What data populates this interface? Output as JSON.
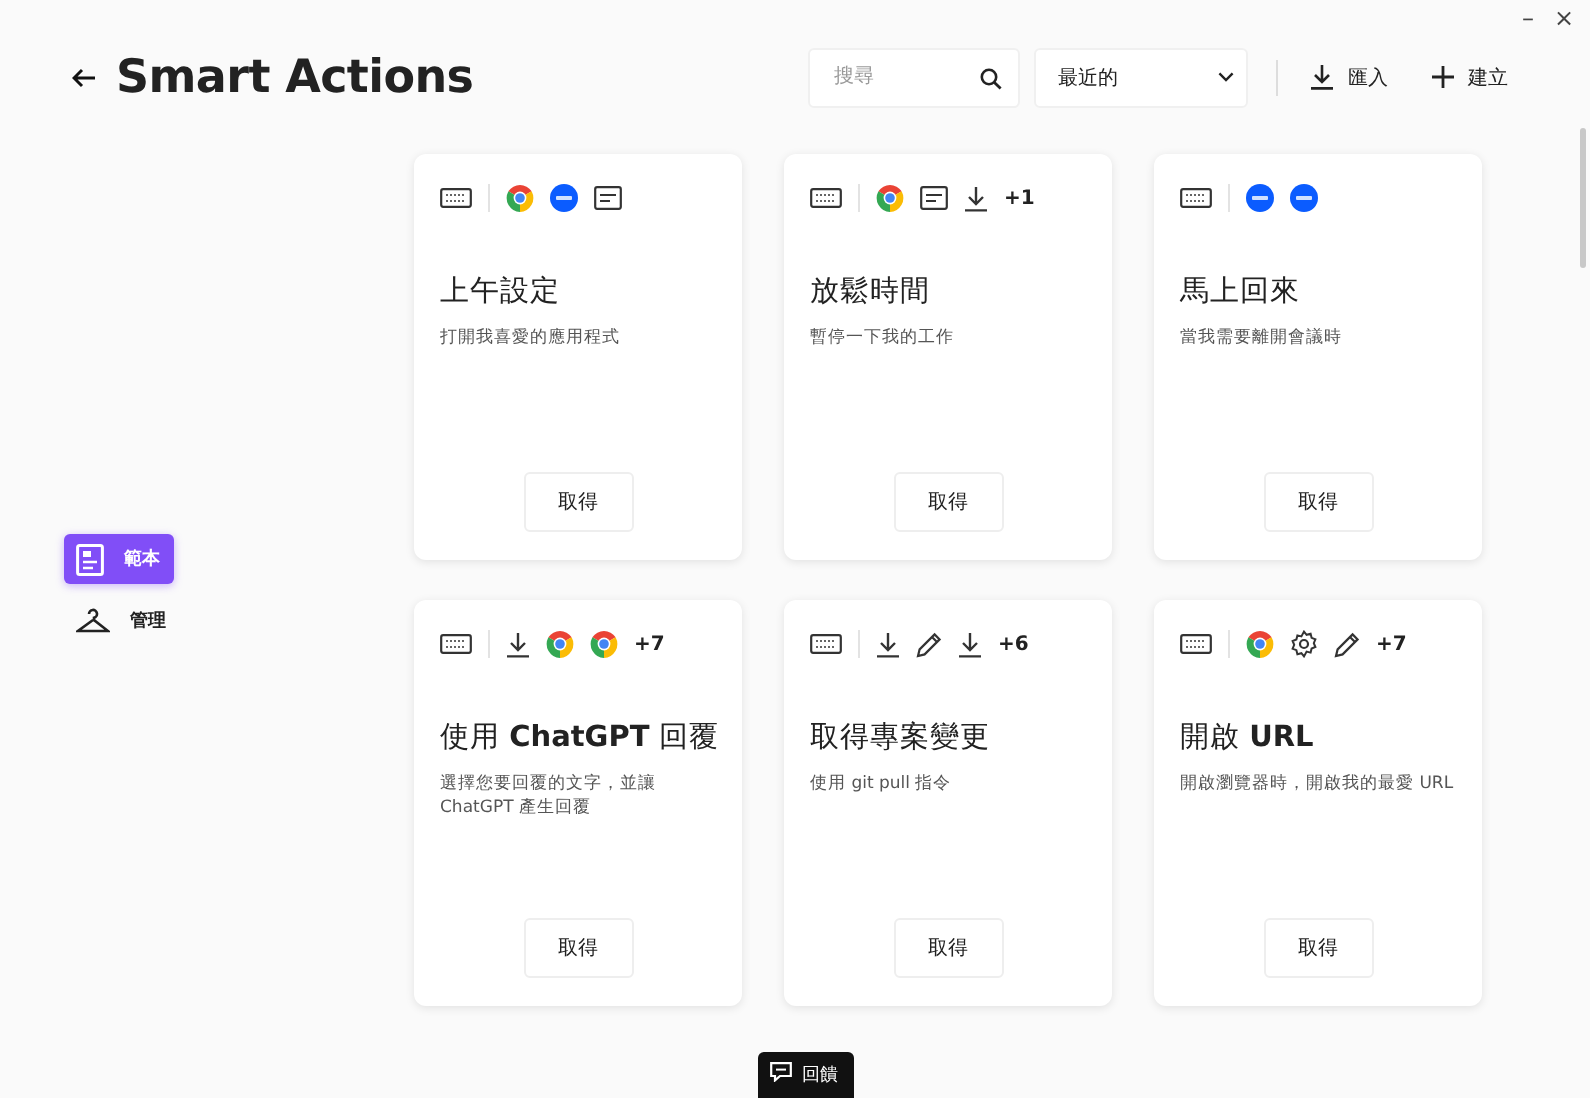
{
  "window": {
    "controls": [
      "–",
      "×"
    ]
  },
  "header": {
    "title": "Smart Actions",
    "search": {
      "placeholder": "搜尋"
    },
    "sort": {
      "value": "最近的"
    },
    "actions": [
      {
        "kind": "import",
        "label": "匯入"
      },
      {
        "kind": "create",
        "label": "建立"
      }
    ]
  },
  "sidebar": {
    "items": [
      {
        "kind": "template",
        "label": "範本",
        "selected": true
      },
      {
        "kind": "hanger",
        "label": "管理",
        "selected": false
      }
    ]
  },
  "cards": [
    {
      "apps": [
        {
          "kind": "keyboard"
        },
        {
          "kind": "chrome"
        },
        {
          "kind": "zoom"
        },
        {
          "kind": "message"
        }
      ],
      "title": "上午設定",
      "description": "打開我喜愛的應用程式",
      "button": "取得"
    },
    {
      "apps": [
        {
          "kind": "keyboard"
        },
        {
          "kind": "chrome"
        },
        {
          "kind": "message"
        },
        {
          "kind": "download"
        }
      ],
      "more": "+1",
      "title": "放鬆時間",
      "description": "暫停一下我的工作",
      "button": "取得"
    },
    {
      "apps": [
        {
          "kind": "keyboard"
        },
        {
          "kind": "zoom"
        },
        {
          "kind": "zoom"
        }
      ],
      "title": "馬上回來",
      "description": "當我需要離開會議時",
      "button": "取得"
    },
    {
      "apps": [
        {
          "kind": "keyboard"
        },
        {
          "kind": "download"
        },
        {
          "kind": "chrome"
        },
        {
          "kind": "chrome"
        }
      ],
      "more": "+7",
      "title": "使用 **ChatGPT** 回覆",
      "description": "選擇您要回覆的文字，並讓 ChatGPT 產生回覆",
      "button": "取得"
    },
    {
      "apps": [
        {
          "kind": "keyboard"
        },
        {
          "kind": "download"
        },
        {
          "kind": "pencil"
        },
        {
          "kind": "download"
        }
      ],
      "more": "+6",
      "title": "取得專案變更",
      "description": "使用 git pull 指令",
      "button": "取得"
    },
    {
      "apps": [
        {
          "kind": "keyboard"
        },
        {
          "kind": "chrome"
        },
        {
          "kind": "gear"
        },
        {
          "kind": "pencil"
        }
      ],
      "more": "+7",
      "title": "開啟 **URL**",
      "description": "開啟瀏覽器時，開啟我的最愛 URL",
      "button": "取得"
    }
  ],
  "feedback": {
    "label": "回饋"
  }
}
